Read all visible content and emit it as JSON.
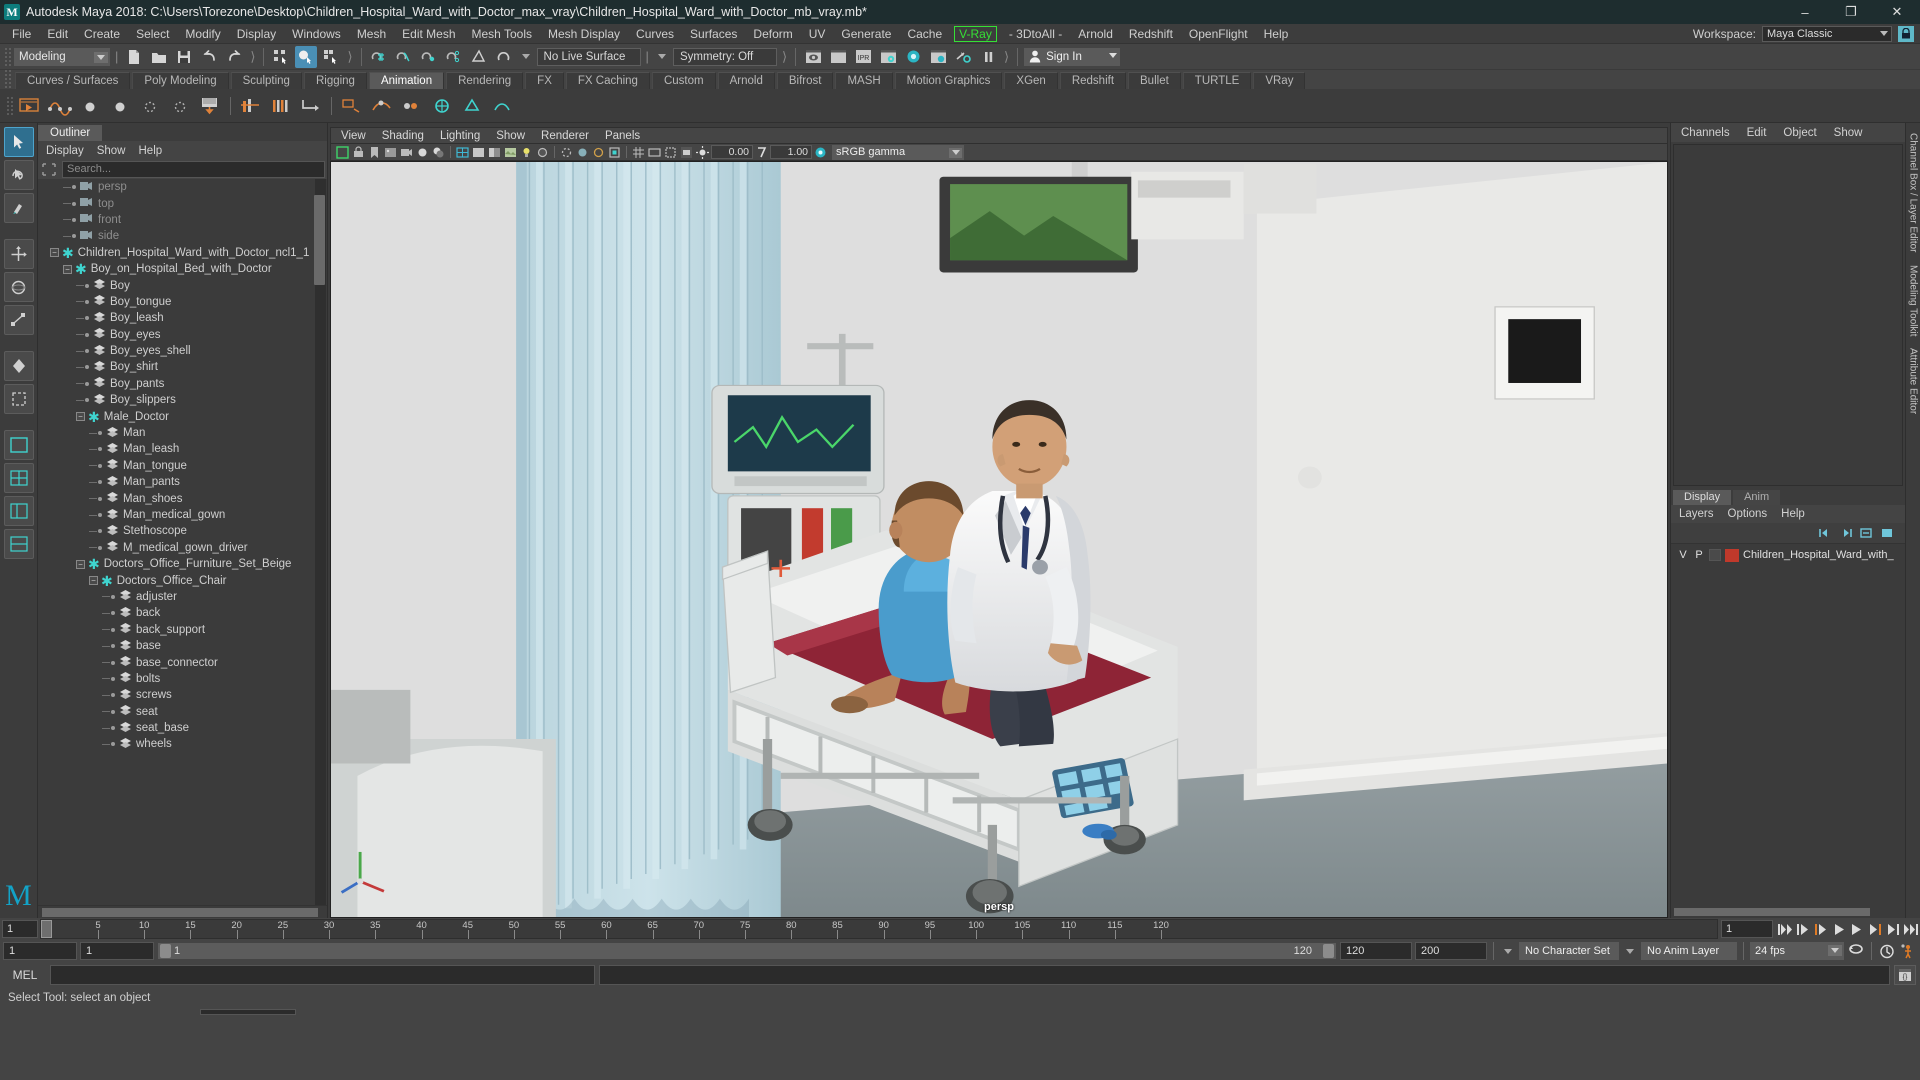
{
  "titlebar": {
    "app_title": "Autodesk Maya 2018: C:\\Users\\Torezone\\Desktop\\Children_Hospital_Ward_with_Doctor_max_vray\\Children_Hospital_Ward_with_Doctor_mb_vray.mb*",
    "logo": "M",
    "minimize": "–",
    "maximize": "❐",
    "close": "✕"
  },
  "menubar": {
    "items": [
      "File",
      "Edit",
      "Create",
      "Select",
      "Modify",
      "Display",
      "Windows",
      "Mesh",
      "Edit Mesh",
      "Mesh Tools",
      "Mesh Display",
      "Curves",
      "Surfaces",
      "Deform",
      "UV",
      "Generate",
      "Cache"
    ],
    "vray": "V-Ray",
    "items_after": [
      "- 3DtoAll -",
      "Arnold",
      "Redshift",
      "OpenFlight",
      "Help"
    ],
    "workspace_label": "Workspace:",
    "workspace_value": "Maya Classic",
    "lock_icon": "lock-icon"
  },
  "statusline": {
    "menu_set": "Modeling",
    "live_surface": "No Live Surface",
    "symmetry": "Symmetry: Off",
    "sign_in": "Sign In",
    "icons": [
      "new-scene-icon",
      "open-scene-icon",
      "save-scene-icon",
      "undo-icon",
      "redo-icon",
      "select-hierarchy-icon",
      "select-object-icon",
      "select-component-icon",
      "snap-grid-icon",
      "snap-curve-icon",
      "snap-point-icon",
      "snap-projected-icon",
      "snap-view-plane-icon",
      "make-live-icon",
      "render-view-icon",
      "render-region-icon",
      "ipr-icon",
      "render-settings-icon",
      "hypershade-icon",
      "render-sequence-icon",
      "toggle-render-icon",
      "pause-icon"
    ]
  },
  "shelf": {
    "tabs": [
      "Curves / Surfaces",
      "Poly Modeling",
      "Sculpting",
      "Rigging",
      "Animation",
      "Rendering",
      "FX",
      "FX Caching",
      "Custom",
      "Arnold",
      "Bifrost",
      "MASH",
      "Motion Graphics",
      "XGen",
      "Redshift",
      "Bullet",
      "TURTLE",
      "VRay"
    ],
    "active_tab": "Animation",
    "icons": [
      "playblast-icon",
      "set-key-icon",
      "set-key-translate-icon",
      "set-key-rotate-icon",
      "set-key-scale-icon",
      "breakdown-key-icon",
      "ghost-icon",
      "ik-handle-icon",
      "ik-spline-icon",
      "set-driven-key-icon",
      "motion-path-icon",
      "motion-trail-icon",
      "animate-snapshot-icon",
      "constraint-parent-icon",
      "constraint-point-icon",
      "constraint-orient-icon"
    ]
  },
  "toolbox": {
    "items": [
      "select-tool",
      "lasso-select-tool",
      "paint-select-tool",
      "move-tool",
      "rotate-tool",
      "scale-tool",
      "last-tool",
      "show-manipulator-tool"
    ],
    "layout_items": [
      "single-perspective-view",
      "four-view-layout",
      "persp-outliner-layout",
      "persp-graph-layout"
    ],
    "logo": "M"
  },
  "outliner": {
    "tab_label": "Outliner",
    "menus": [
      "Display",
      "Show",
      "Help"
    ],
    "search_placeholder": "Search...",
    "search_icon": "search-icon",
    "tree": [
      {
        "label": "persp",
        "depth": 1,
        "icon": "camera-icon",
        "dim": true,
        "expander": null
      },
      {
        "label": "top",
        "depth": 1,
        "icon": "camera-icon",
        "dim": true,
        "expander": null
      },
      {
        "label": "front",
        "depth": 1,
        "icon": "camera-icon",
        "dim": true,
        "expander": null
      },
      {
        "label": "side",
        "depth": 1,
        "icon": "camera-icon",
        "dim": true,
        "expander": null
      },
      {
        "label": "Children_Hospital_Ward_with_Doctor_ncl1_1",
        "depth": 0,
        "icon": "group-icon",
        "dim": false,
        "expander": "minus"
      },
      {
        "label": "Boy_on_Hospital_Bed_with_Doctor",
        "depth": 1,
        "icon": "group-icon",
        "dim": false,
        "expander": "minus"
      },
      {
        "label": "Boy",
        "depth": 2,
        "icon": "mesh-icon",
        "dim": false,
        "expander": null
      },
      {
        "label": "Boy_tongue",
        "depth": 2,
        "icon": "mesh-icon",
        "dim": false,
        "expander": null
      },
      {
        "label": "Boy_leash",
        "depth": 2,
        "icon": "mesh-icon",
        "dim": false,
        "expander": null
      },
      {
        "label": "Boy_eyes",
        "depth": 2,
        "icon": "mesh-icon",
        "dim": false,
        "expander": null
      },
      {
        "label": "Boy_eyes_shell",
        "depth": 2,
        "icon": "mesh-icon",
        "dim": false,
        "expander": null
      },
      {
        "label": "Boy_shirt",
        "depth": 2,
        "icon": "mesh-icon",
        "dim": false,
        "expander": null
      },
      {
        "label": "Boy_pants",
        "depth": 2,
        "icon": "mesh-icon",
        "dim": false,
        "expander": null
      },
      {
        "label": "Boy_slippers",
        "depth": 2,
        "icon": "mesh-icon",
        "dim": false,
        "expander": null
      },
      {
        "label": "Male_Doctor",
        "depth": 2,
        "icon": "group-icon",
        "dim": false,
        "expander": "minus"
      },
      {
        "label": "Man",
        "depth": 3,
        "icon": "mesh-icon",
        "dim": false,
        "expander": null
      },
      {
        "label": "Man_leash",
        "depth": 3,
        "icon": "mesh-icon",
        "dim": false,
        "expander": null
      },
      {
        "label": "Man_tongue",
        "depth": 3,
        "icon": "mesh-icon",
        "dim": false,
        "expander": null
      },
      {
        "label": "Man_pants",
        "depth": 3,
        "icon": "mesh-icon",
        "dim": false,
        "expander": null
      },
      {
        "label": "Man_shoes",
        "depth": 3,
        "icon": "mesh-icon",
        "dim": false,
        "expander": null
      },
      {
        "label": "Man_medical_gown",
        "depth": 3,
        "icon": "mesh-icon",
        "dim": false,
        "expander": null
      },
      {
        "label": "Stethoscope",
        "depth": 3,
        "icon": "mesh-icon",
        "dim": false,
        "expander": null
      },
      {
        "label": "M_medical_gown_driver",
        "depth": 3,
        "icon": "mesh-icon",
        "dim": false,
        "expander": null
      },
      {
        "label": "Doctors_Office_Furniture_Set_Beige",
        "depth": 2,
        "icon": "group-icon",
        "dim": false,
        "expander": "minus"
      },
      {
        "label": "Doctors_Office_Chair",
        "depth": 3,
        "icon": "group-icon",
        "dim": false,
        "expander": "minus"
      },
      {
        "label": "adjuster",
        "depth": 4,
        "icon": "mesh-icon",
        "dim": false,
        "expander": null
      },
      {
        "label": "back",
        "depth": 4,
        "icon": "mesh-icon",
        "dim": false,
        "expander": null
      },
      {
        "label": "back_support",
        "depth": 4,
        "icon": "mesh-icon",
        "dim": false,
        "expander": null
      },
      {
        "label": "base",
        "depth": 4,
        "icon": "mesh-icon",
        "dim": false,
        "expander": null
      },
      {
        "label": "base_connector",
        "depth": 4,
        "icon": "mesh-icon",
        "dim": false,
        "expander": null
      },
      {
        "label": "bolts",
        "depth": 4,
        "icon": "mesh-icon",
        "dim": false,
        "expander": null
      },
      {
        "label": "screws",
        "depth": 4,
        "icon": "mesh-icon",
        "dim": false,
        "expander": null
      },
      {
        "label": "seat",
        "depth": 4,
        "icon": "mesh-icon",
        "dim": false,
        "expander": null
      },
      {
        "label": "seat_base",
        "depth": 4,
        "icon": "mesh-icon",
        "dim": false,
        "expander": null
      },
      {
        "label": "wheels",
        "depth": 4,
        "icon": "mesh-icon",
        "dim": false,
        "expander": null
      }
    ]
  },
  "viewport": {
    "menus": [
      "View",
      "Shading",
      "Lighting",
      "Show",
      "Renderer",
      "Panels"
    ],
    "exposure_value": "0.00",
    "gamma_value": "1.00",
    "color_space": "sRGB gamma",
    "camera_label": "persp",
    "toolbar_icons": [
      "select-camera-icon",
      "lock-camera-icon",
      "bookmark-icon",
      "image-plane-icon",
      "two-sided-lighting-icon",
      "shadows-icon",
      "wireframe-icon",
      "smooth-shade-icon",
      "flat-shade-icon",
      "textured-icon",
      "use-lights-icon",
      "xray-icon",
      "xray-joints-icon",
      "isolate-select-icon",
      "grid-icon",
      "film-gate-icon",
      "resolution-gate-icon",
      "gate-mask-icon",
      "exposure-icon",
      "gamma-icon",
      "color-management-icon"
    ]
  },
  "right_panel": {
    "menus": [
      "Channels",
      "Edit",
      "Object",
      "Show"
    ],
    "layer_tabs": [
      "Display",
      "Anim"
    ],
    "active_layer_tab": "Display",
    "layer_menus": [
      "Layers",
      "Options",
      "Help"
    ],
    "layer_row": {
      "v": "V",
      "p": "P",
      "name": "Children_Hospital_Ward_with_",
      "color": "#c0392b"
    },
    "vertical_tabs": [
      "Channel Box / Layer Editor",
      "Modeling Toolkit",
      "Attribute Editor"
    ]
  },
  "timeline": {
    "current_frame_left": "1",
    "ticks": [
      {
        "label": "5",
        "frame": 5
      },
      {
        "label": "10",
        "frame": 10
      },
      {
        "label": "15",
        "frame": 15
      },
      {
        "label": "20",
        "frame": 20
      },
      {
        "label": "25",
        "frame": 25
      },
      {
        "label": "30",
        "frame": 30
      },
      {
        "label": "35",
        "frame": 35
      },
      {
        "label": "40",
        "frame": 40
      },
      {
        "label": "45",
        "frame": 45
      },
      {
        "label": "50",
        "frame": 50
      },
      {
        "label": "55",
        "frame": 55
      },
      {
        "label": "60",
        "frame": 60
      },
      {
        "label": "65",
        "frame": 65
      },
      {
        "label": "70",
        "frame": 70
      },
      {
        "label": "75",
        "frame": 75
      },
      {
        "label": "80",
        "frame": 80
      },
      {
        "label": "85",
        "frame": 85
      },
      {
        "label": "90",
        "frame": 90
      },
      {
        "label": "95",
        "frame": 95
      },
      {
        "label": "100",
        "frame": 100
      },
      {
        "label": "105",
        "frame": 105
      },
      {
        "label": "110",
        "frame": 110
      },
      {
        "label": "115",
        "frame": 115
      },
      {
        "label": "120",
        "frame": 120
      }
    ],
    "range_start": 1,
    "range_end": 120,
    "playback_frame": "1",
    "playback_icons": [
      "go-to-start-icon",
      "step-back-keyframe-icon",
      "step-back-frame-icon",
      "play-backwards-icon",
      "play-forwards-icon",
      "step-forward-frame-icon",
      "step-forward-keyframe-icon",
      "go-to-end-icon"
    ]
  },
  "range_bar": {
    "anim_start": "1",
    "range_start": "1",
    "slider_start_label": "1",
    "slider_end_label": "120",
    "range_end": "120",
    "anim_end": "200",
    "character_set": "No Character Set",
    "anim_layer": "No Anim Layer",
    "fps": "24 fps",
    "loop_icon": "loop-icon",
    "auto_key_icon": "auto-key-icon",
    "anim_prefs_icon": "animation-preferences-icon"
  },
  "mel": {
    "label": "MEL",
    "input_value": "",
    "output_value": "",
    "script_editor_icon": "script-editor-icon"
  },
  "helpline": {
    "text": "Select Tool: select an object"
  },
  "colors": {
    "accent_teal": "#3fd4cf",
    "accent_blue": "#4a8fb5",
    "vray_green": "#35e035",
    "orange": "#e07b26",
    "panel_bg": "#3c3c3c",
    "dark_bg": "#2b2b2b"
  }
}
